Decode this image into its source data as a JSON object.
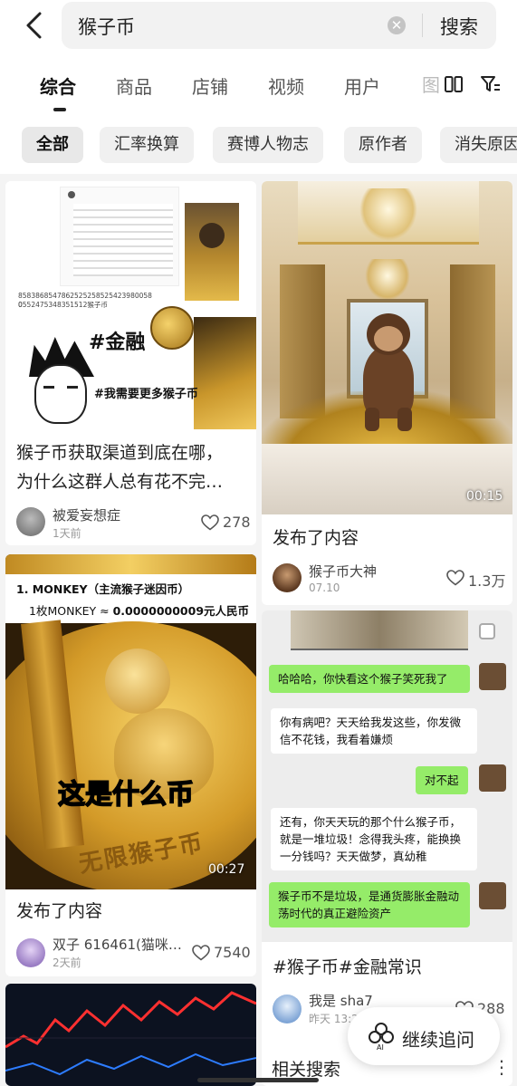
{
  "search": {
    "query": "猴子币",
    "submit_label": "搜索"
  },
  "tabs": [
    {
      "label": "综合"
    },
    {
      "label": "商品"
    },
    {
      "label": "店铺"
    },
    {
      "label": "视频"
    },
    {
      "label": "用户"
    },
    {
      "label": "图"
    }
  ],
  "chips": [
    {
      "label": "全部"
    },
    {
      "label": "汇率换算"
    },
    {
      "label": "赛博人物志"
    },
    {
      "label": "原作者"
    },
    {
      "label": "消失原因"
    }
  ],
  "feed": [
    {
      "title": "猴子币获取渠道到底在哪，为什么这群人总有花不完…",
      "title_line1": "猴子币获取渠道到底在哪，",
      "title_line2": "为什么这群人总有花不完…",
      "author": "被爱妄想症",
      "date": "1天前",
      "likes": "278",
      "thumb_text": {
        "tag_finance": "#金融",
        "tag_need": "#我需要更多猴子币",
        "digits": "85838685478625252585254239800580",
        "digits2": "0552475348351512猴子币"
      }
    },
    {
      "title": "发布了内容",
      "author": "猴子币大神",
      "date": "07.10",
      "likes": "1.3万",
      "duration": "00:15"
    },
    {
      "title": "发布了内容",
      "author": "双子 616461(猫咪…",
      "date": "2天前",
      "likes": "7540",
      "duration": "00:27",
      "thumb_text": {
        "header": "1. MONKEY（主流猴子迷因币）",
        "rate_prefix": "1枚MONKEY ≈ ",
        "rate_value": "0.0000000009元人民币",
        "caption": "这是什么币",
        "coin_text": "无限猴子币"
      }
    },
    {
      "title": "#猴子币#金融常识",
      "author": "我是 sha7",
      "date": "昨天 13:2",
      "likes": "288",
      "chat": [
        {
          "side": "right",
          "text": "哈哈哈，你快看这个猴子笑死我了"
        },
        {
          "side": "left",
          "text": "你有病吧？天天给我发这些，你发微信不花钱，我看着嫌烦"
        },
        {
          "side": "right",
          "text": "对不起"
        },
        {
          "side": "left",
          "text": "还有，你天天玩的那个什么猴子币，就是一堆垃圾！念得我头疼，能换换一分钱吗？天天做梦，真幼稚"
        },
        {
          "side": "right",
          "text": "猴子币不是垃圾，是通货膨胀金融动荡时代的真正避险资产"
        }
      ]
    }
  ],
  "floating": {
    "label": "继续追问",
    "icon": "ai-icon"
  },
  "related_title": "相关搜索",
  "colors": {
    "chat_green": "#95ec69",
    "gold": "#c9962b"
  }
}
